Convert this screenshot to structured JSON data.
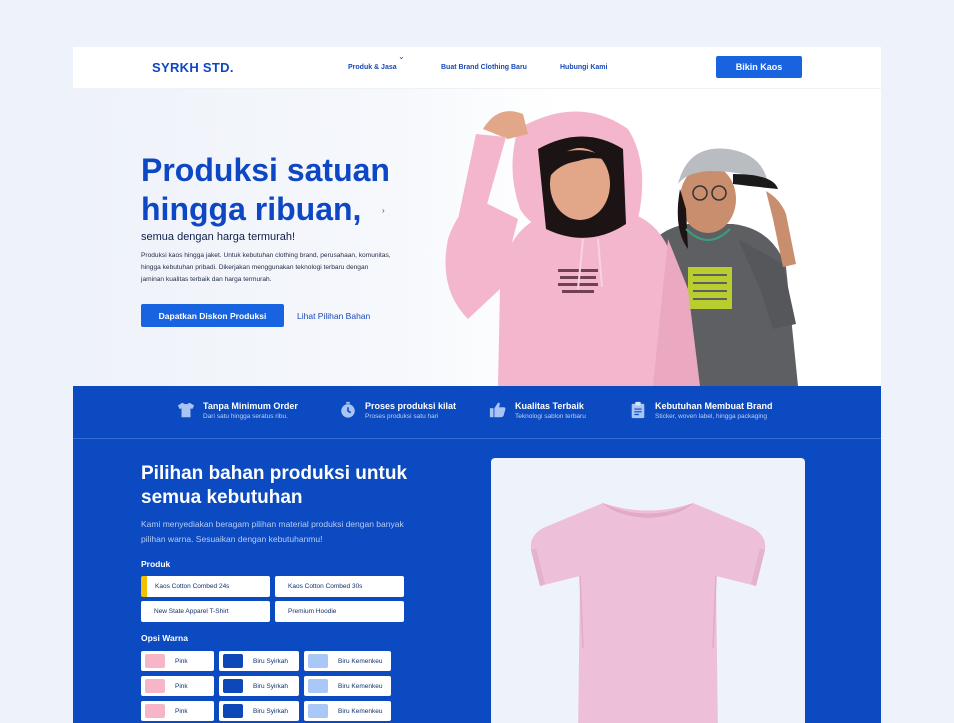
{
  "nav": {
    "logo": "SYRKH STD.",
    "links": [
      "Produk & Jasa",
      "Buat Brand Clothing Baru",
      "Hubungi Kami"
    ],
    "cta": "Bikin Kaos"
  },
  "hero": {
    "title": "Produksi satuan hingga ribuan,",
    "subtitle": "semua dengan harga termurah!",
    "description": "Produksi kaos hingga jaket. Untuk kebutuhan clothing brand, perusahaan, komunitas, hingga kebutuhan pribadi. Dikerjakan menggunakan teknologi terbaru dengan jaminan kualitas terbaik dan harga termurah.",
    "primary_button": "Dapatkan Diskon Produksi",
    "secondary_link": "Lihat Pilihan Bahan"
  },
  "features": [
    {
      "icon": "tshirt-icon",
      "title": "Tanpa Minimum Order",
      "desc": "Dari satu hingga seratus ribu."
    },
    {
      "icon": "stopwatch-icon",
      "title": "Proses produksi kilat",
      "desc": "Proses produksi satu hari"
    },
    {
      "icon": "thumbs-up-icon",
      "title": "Kualitas Terbaik",
      "desc": "Teknologi sablon terbaru"
    },
    {
      "icon": "clipboard-icon",
      "title": "Kebutuhan Membuat Brand",
      "desc": "Sticker, woven label, hingga packaging"
    }
  ],
  "materials": {
    "title": "Pilihan bahan produksi untuk semua kebutuhan",
    "description": "Kami menyediakan beragam pilihan material produksi dengan banyak pilihan warna. Sesuaikan dengan kebutuhanmu!",
    "product_label": "Produk",
    "products": [
      "Kaos Cotton Combed 24s",
      "Kaos Cotton Combed 30s",
      "New State Apparel T-Shirt",
      "Premium Hoodie"
    ],
    "color_label": "Opsi Warna",
    "colors": [
      [
        "Pink",
        "Biru Syirkah",
        "Biru Kemenkeu"
      ],
      [
        "Pink",
        "Biru Syirkah",
        "Biru Kemenkeu"
      ],
      [
        "Pink",
        "Biru Syirkah",
        "Biru Kemenkeu"
      ]
    ],
    "swatch_colors": {
      "Pink": "#f7b6c8",
      "Biru Syirkah": "#0d47b8",
      "Biru Kemenkeu": "#a9c8f8"
    }
  },
  "colors": {
    "brand_blue": "#0d47c4",
    "band_blue": "#0b4ac0",
    "button_blue": "#1864e0",
    "accent_yellow": "#f5c000"
  }
}
